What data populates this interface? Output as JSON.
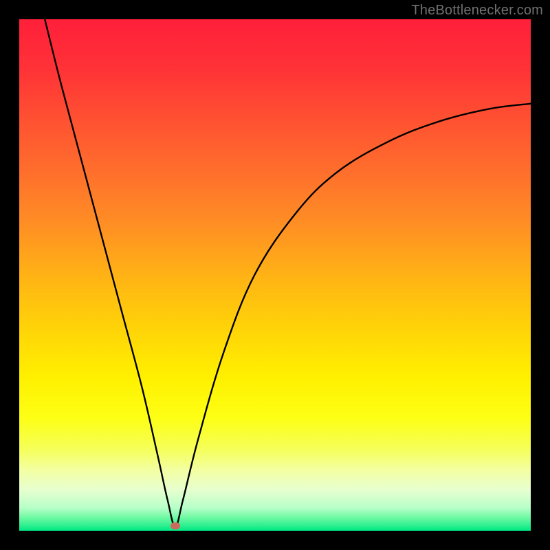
{
  "attribution": "TheBottlenecker.com",
  "colors": {
    "marker": "#c96a5c",
    "curve": "#000000",
    "frame": "#000000",
    "gradient_stops": [
      {
        "offset": 0.0,
        "color": "#ff1f3a"
      },
      {
        "offset": 0.1,
        "color": "#ff3337"
      },
      {
        "offset": 0.2,
        "color": "#ff5231"
      },
      {
        "offset": 0.3,
        "color": "#ff6f2c"
      },
      {
        "offset": 0.4,
        "color": "#ff8e24"
      },
      {
        "offset": 0.5,
        "color": "#ffb215"
      },
      {
        "offset": 0.6,
        "color": "#ffd208"
      },
      {
        "offset": 0.7,
        "color": "#fff000"
      },
      {
        "offset": 0.78,
        "color": "#fdff15"
      },
      {
        "offset": 0.84,
        "color": "#f5ff58"
      },
      {
        "offset": 0.88,
        "color": "#f3ffa0"
      },
      {
        "offset": 0.92,
        "color": "#e7ffcf"
      },
      {
        "offset": 0.955,
        "color": "#b7ffc8"
      },
      {
        "offset": 0.975,
        "color": "#6cf9a1"
      },
      {
        "offset": 1.0,
        "color": "#00e884"
      }
    ]
  },
  "chart_data": {
    "type": "line",
    "title": "",
    "xlabel": "",
    "ylabel": "",
    "xlim": [
      0,
      100
    ],
    "ylim": [
      0,
      100
    ],
    "marker": {
      "x": 30.5,
      "y": 1.0
    },
    "series": [
      {
        "name": "curve",
        "x": [
          5,
          8,
          12,
          16,
          20,
          24,
          27,
          29,
          30.5,
          32,
          35,
          40,
          46,
          54,
          62,
          72,
          82,
          92,
          100
        ],
        "y": [
          100,
          88,
          73,
          58,
          43,
          28,
          15,
          6,
          0.8,
          6,
          18,
          35,
          50,
          62,
          70,
          76,
          80,
          82.5,
          83.5
        ]
      }
    ]
  }
}
